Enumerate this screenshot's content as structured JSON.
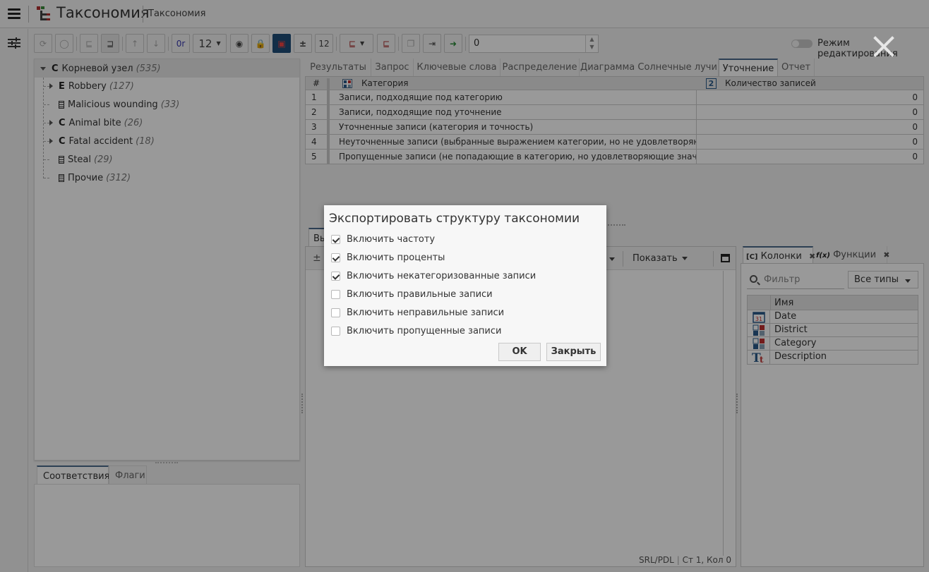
{
  "header": {
    "app_title": "Таксономия",
    "breadcrumb": "Таксономия"
  },
  "toolbar": {
    "font_size_value": "12",
    "or_label": "0r",
    "count_input_value": "0",
    "edit_mode_label": "Режим редактирования",
    "edit_mode_on": false
  },
  "tree": {
    "root": {
      "type": "C",
      "label": "Корневой узел",
      "count": "(535)"
    },
    "items": [
      {
        "type": "E",
        "label": "Robbery",
        "count": "(127)",
        "expandable": true
      },
      {
        "type": "doc",
        "label": "Malicious wounding",
        "count": "(33)",
        "expandable": false
      },
      {
        "type": "C",
        "label": "Animal bite",
        "count": "(26)",
        "expandable": true
      },
      {
        "type": "C",
        "label": "Fatal accident",
        "count": "(18)",
        "expandable": true
      },
      {
        "type": "doc",
        "label": "Steal",
        "count": "(29)",
        "expandable": false
      },
      {
        "type": "doc",
        "label": "Прочие",
        "count": "(312)",
        "expandable": false
      }
    ]
  },
  "bottom_tabs": [
    {
      "label": "Соответствия",
      "active": true
    },
    {
      "label": "Флаги",
      "active": false
    }
  ],
  "main_tabs": [
    {
      "label": "Результаты",
      "active": false
    },
    {
      "label": "Запрос",
      "active": false
    },
    {
      "label": "Ключевые слова",
      "active": false
    },
    {
      "label": "Распределение",
      "active": false
    },
    {
      "label": "Диаграмма Солнечные лучи",
      "active": false
    },
    {
      "label": "Уточнение",
      "active": true
    },
    {
      "label": "Отчет",
      "active": false
    }
  ],
  "refinement_table": {
    "headers": {
      "num": "#",
      "category": "Категория",
      "count": "Количество записей",
      "count_icon": "2"
    },
    "rows": [
      {
        "num": "1",
        "category": "Записи, подходящие под категорию",
        "count": "0"
      },
      {
        "num": "2",
        "category": "Записи, подходящие под уточнение",
        "count": "0"
      },
      {
        "num": "3",
        "category": "Уточненные записи (категория и точность)",
        "count": "0"
      },
      {
        "num": "4",
        "category": "Неуточненные записи (выбранные выражением категории, но не удовлетворяющие значению уточнения)",
        "count": "0"
      },
      {
        "num": "5",
        "category": "Пропущенные записи (не попадающие в категорию, но удовлетворяющие значению уточнения)",
        "count": "0"
      }
    ]
  },
  "editor": {
    "tab_label": "Вы",
    "pm_symbol": "±",
    "show_label": "Показать",
    "status": "SRL/PDL",
    "position": "Ст 1, Кол 0"
  },
  "columns_panel": {
    "tabs": [
      {
        "label": "Колонки",
        "prefix": "[C]",
        "active": true
      },
      {
        "label": "Функции",
        "prefix": "f(x)",
        "active": false
      }
    ],
    "filter_placeholder": "Фильтр",
    "types_select": "Все типы",
    "name_header": "Имя",
    "columns": [
      {
        "name": "Date",
        "icon": "calendar-icon"
      },
      {
        "name": "District",
        "icon": "category-icon"
      },
      {
        "name": "Category",
        "icon": "category-icon"
      },
      {
        "name": "Description",
        "icon": "text-icon"
      }
    ]
  },
  "dialog": {
    "title": "Экспортировать структуру таксономии",
    "options": [
      {
        "label": "Включить частоту",
        "checked": true
      },
      {
        "label": "Включить проценты",
        "checked": true
      },
      {
        "label": "Включить некатегоризованные записи",
        "checked": true
      },
      {
        "label": "Включить правильные записи",
        "checked": false
      },
      {
        "label": "Включить неправильные записи",
        "checked": false
      },
      {
        "label": "Включить пропущенные записи",
        "checked": false
      }
    ],
    "ok_label": "OK",
    "close_label": "Закрыть"
  }
}
